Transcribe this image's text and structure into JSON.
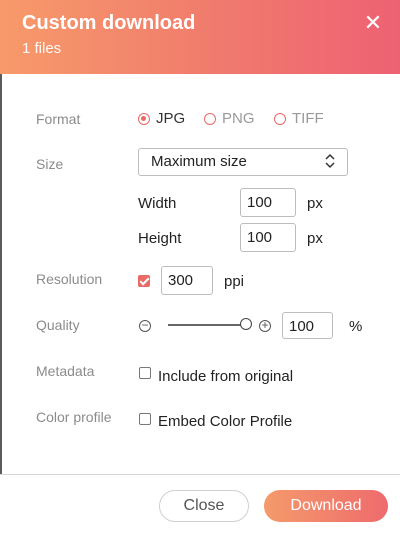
{
  "dialog": {
    "title": "Custom download",
    "subtitle": "1 files",
    "close_icon": "✕"
  },
  "format": {
    "label": "Format",
    "options": [
      {
        "label": "JPG",
        "selected": true
      },
      {
        "label": "PNG",
        "selected": false
      },
      {
        "label": "TIFF",
        "selected": false
      }
    ]
  },
  "size": {
    "label": "Size",
    "selected": "Maximum size",
    "chevron": "⌃⌄",
    "width_label": "Width",
    "width_value": "100",
    "width_unit": "px",
    "height_label": "Height",
    "height_value": "100",
    "height_unit": "px"
  },
  "resolution": {
    "label": "Resolution",
    "enabled": true,
    "value": "300",
    "unit": "ppi"
  },
  "quality": {
    "label": "Quality",
    "minus_icon": "−",
    "plus_icon": "+",
    "value": "100",
    "unit": "%",
    "slider_percent": 100
  },
  "metadata": {
    "label": "Metadata",
    "checkbox_label": "Include from original",
    "checked": false
  },
  "color_profile": {
    "label": "Color profile",
    "checkbox_label": "Embed Color Profile",
    "checked": false
  },
  "footer": {
    "close_label": "Close",
    "download_label": "Download"
  }
}
